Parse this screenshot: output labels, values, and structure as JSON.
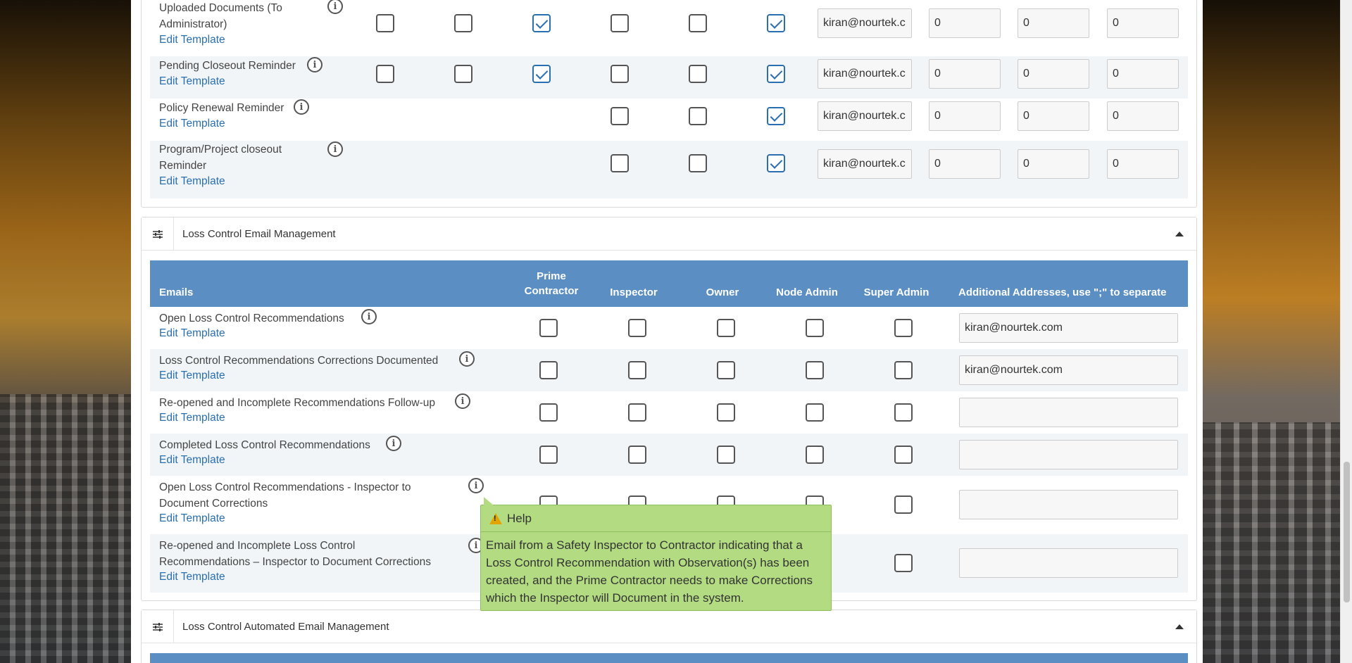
{
  "top_section": {
    "rows": [
      {
        "label_line1": "Uploaded Documents (To",
        "label_line2": "Administrator)",
        "edit": "Edit Template",
        "email": "kiran@nourtek.c",
        "n1": "0",
        "n2": "0",
        "n3": "0"
      },
      {
        "label_line1": "Pending Closeout Reminder",
        "edit": "Edit Template",
        "email": "kiran@nourtek.c",
        "n1": "0",
        "n2": "0",
        "n3": "0"
      },
      {
        "label_line1": "Policy Renewal Reminder",
        "edit": "Edit Template",
        "email": "kiran@nourtek.c",
        "n1": "0",
        "n2": "0",
        "n3": "0"
      },
      {
        "label_line1": "Program/Project closeout",
        "label_line2": "Reminder",
        "edit": "Edit Template",
        "email": "kiran@nourtek.c",
        "n1": "0",
        "n2": "0",
        "n3": "0"
      }
    ]
  },
  "loss_control": {
    "title": "Loss Control Email Management",
    "headers": {
      "emails": "Emails",
      "prime_line1": "Prime",
      "prime_line2": "Contractor",
      "inspector": "Inspector",
      "owner": "Owner",
      "node_admin": "Node Admin",
      "super_admin": "Super Admin",
      "additional": "Additional Addresses, use \";\" to separate"
    },
    "rows": [
      {
        "label_line1": "Open Loss Control Recommendations",
        "edit": "Edit Template",
        "email": "kiran@nourtek.com"
      },
      {
        "label_line1": "Loss Control Recommendations Corrections Documented",
        "edit": "Edit Template",
        "email": "kiran@nourtek.com"
      },
      {
        "label_line1": "Re-opened and Incomplete Recommendations Follow-up",
        "edit": "Edit Template",
        "email": ""
      },
      {
        "label_line1": "Completed Loss Control Recommendations",
        "edit": "Edit Template",
        "email": ""
      },
      {
        "label_line1": "Open Loss Control Recommendations - Inspector to",
        "label_line2": "Document Corrections",
        "edit": "Edit Template",
        "email": ""
      },
      {
        "label_line1": "Re-opened and Incomplete Loss Control",
        "label_line2": "Recommendations – Inspector to Document Corrections",
        "edit": "Edit Template",
        "email": ""
      }
    ]
  },
  "automated": {
    "title": "Loss Control Automated Email Management"
  },
  "tooltip": {
    "title": "Help",
    "body": "Email from a Safety Inspector to Contractor indicating that a Loss Control Recommendation with Observation(s) has been created, and the Prime Contractor needs to make Corrections which the Inspector will Document in the system."
  },
  "colors": {
    "table_header": "#5b8fc3",
    "link": "#2a6fb0",
    "tooltip_bg": "#b3db82"
  }
}
